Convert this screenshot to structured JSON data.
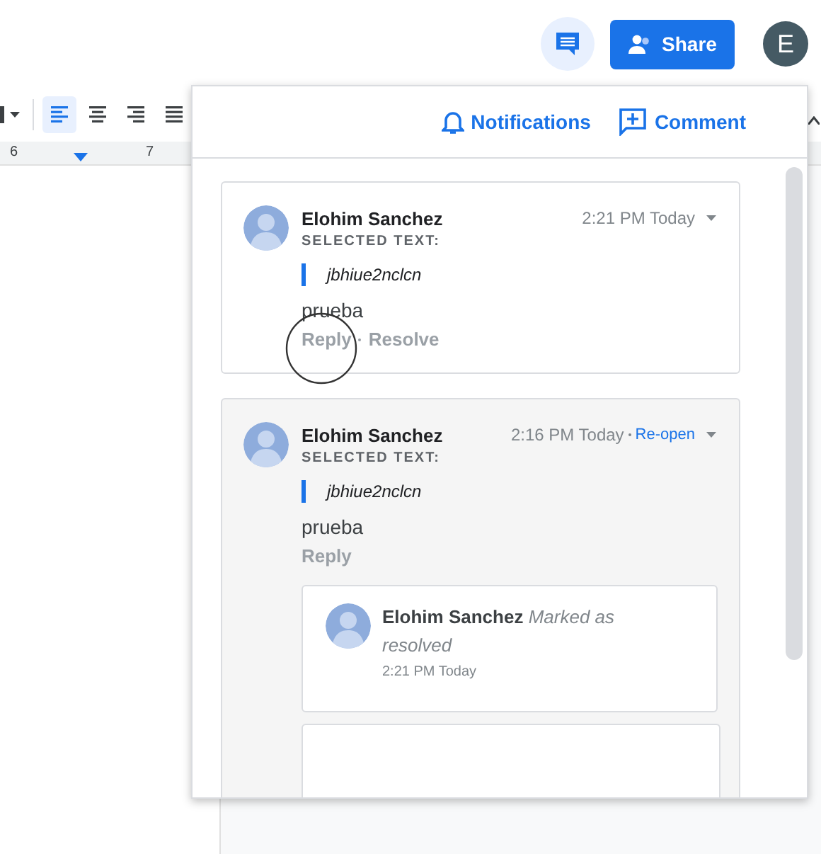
{
  "topbar": {
    "comments_active": true,
    "share": "Share",
    "account_initial": "E"
  },
  "toolbar": {
    "align_buttons": [
      {
        "kind": "left",
        "selected": true
      },
      {
        "kind": "center",
        "selected": false
      },
      {
        "kind": "right",
        "selected": false
      },
      {
        "kind": "justify",
        "selected": false
      }
    ]
  },
  "ruler": {
    "marks": [
      "6",
      "7"
    ]
  },
  "panel": {
    "actions": [
      {
        "kind": "notifications",
        "label": "Notifications"
      },
      {
        "kind": "comment",
        "label": "Comment"
      }
    ],
    "threads": [
      {
        "author": "Elohim Sanchez",
        "time": "2:21 PM Today",
        "selected_label": "SELECTED TEXT:",
        "quote": "jbhiue2nclcn",
        "body": "prueba",
        "resolved": false,
        "actions": [
          "Reply",
          "Resolve"
        ]
      },
      {
        "author": "Elohim Sanchez",
        "time": "2:16 PM Today",
        "reopen": "Re-open",
        "selected_label": "SELECTED TEXT:",
        "quote": "jbhiue2nclcn",
        "body": "prueba",
        "resolved": true,
        "actions": [
          "Reply"
        ],
        "replies": [
          {
            "author": "Elohim Sanchez",
            "note": "Marked as resolved",
            "time": "2:21 PM Today"
          }
        ]
      }
    ]
  }
}
